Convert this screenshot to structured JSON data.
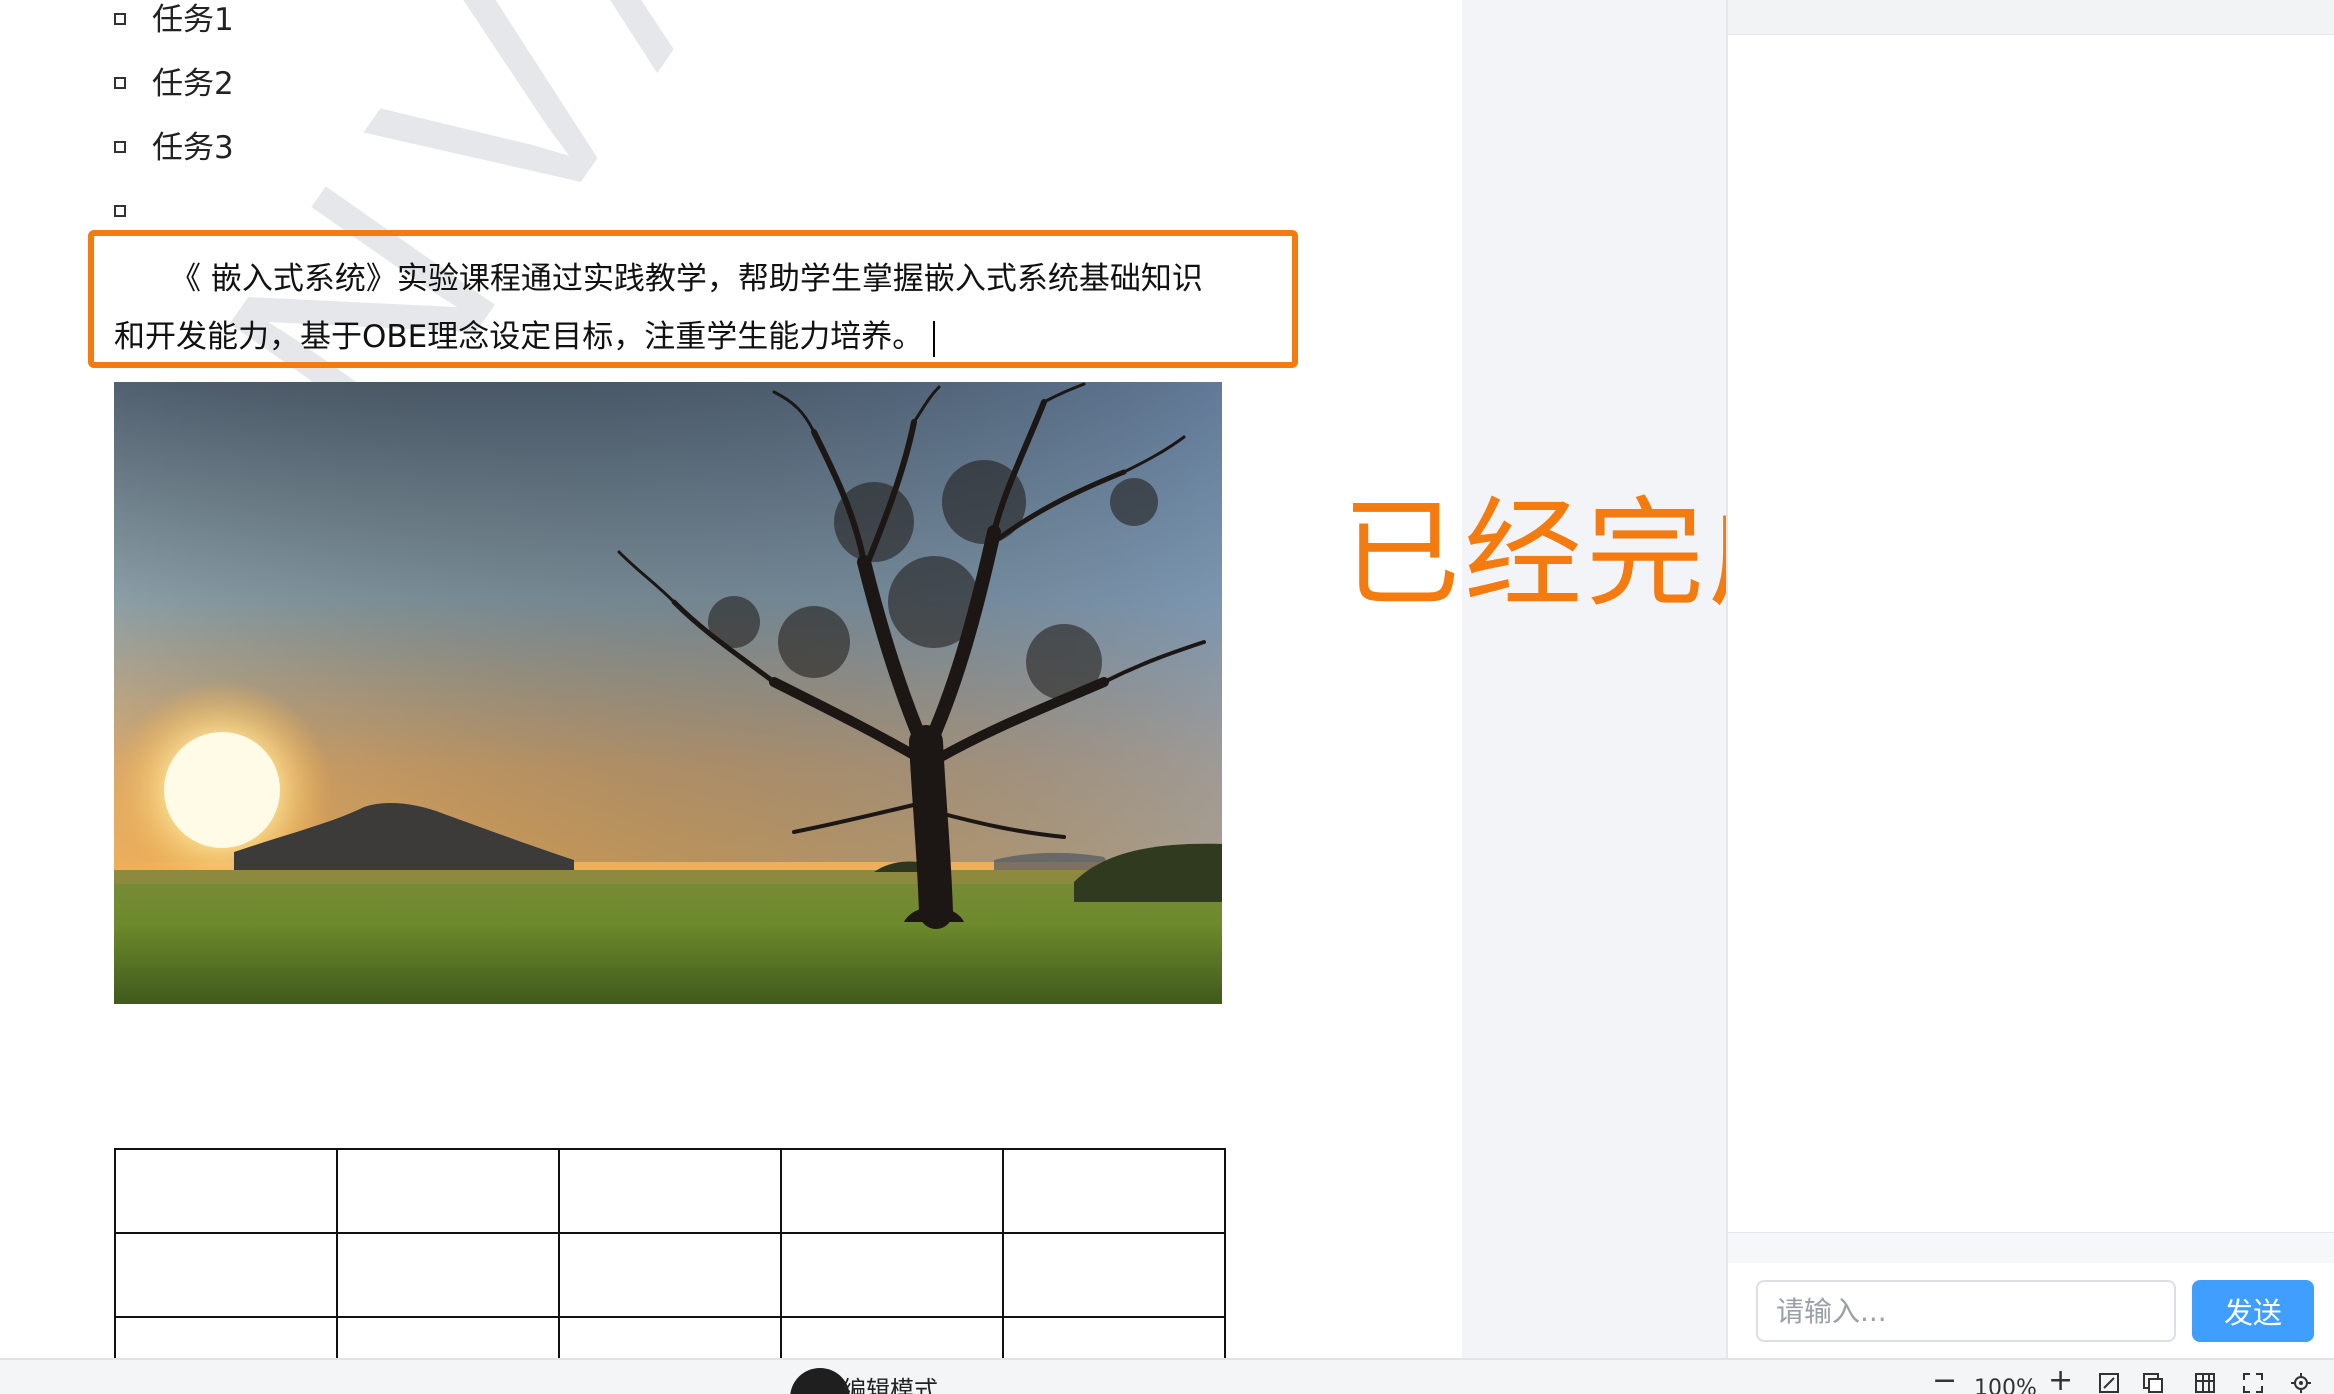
{
  "document": {
    "task_list": [
      "任务1",
      "任务2",
      "任务3",
      ""
    ],
    "paragraph": "《 嵌入式系统》实验课程通过实践教学，帮助学生掌握嵌入式系统基础知识和开发能力，基于OBE理念设定目标，注重学生能力培养。",
    "watermark": "ANVA FOR",
    "table": {
      "rows": 3,
      "cols": 5
    }
  },
  "annotation": {
    "text": "已经完成了替换",
    "color": "#f47b10"
  },
  "chat": {
    "input_placeholder": "请输入...",
    "send_label": "发送",
    "accent": "#409eff"
  },
  "status_bar": {
    "mode_label": "编辑模式",
    "zoom_out": "−",
    "zoom_value": "100%",
    "zoom_in": "+"
  }
}
